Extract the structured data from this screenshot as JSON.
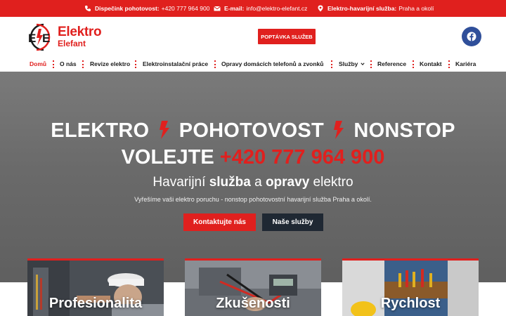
{
  "topbar": {
    "dispatch_label": "Dispečink pohotovost:",
    "dispatch_value": "+420 777 964 900",
    "email_label": "E-mail:",
    "email_value": "info@elektro-elefant.cz",
    "emergency_label": "Elektro-havarijní služba:",
    "emergency_value": "Praha a okolí"
  },
  "header": {
    "logo_line1": "Elektro",
    "logo_line2": "Elefant",
    "cta_label": "POPTÁVKA SLUŽEB"
  },
  "nav": {
    "items": [
      {
        "label": "Domů",
        "active": true
      },
      {
        "label": "O nás"
      },
      {
        "label": "Revize elektro"
      },
      {
        "label": "Elektroinstalační práce"
      },
      {
        "label": "Opravy domácích telefonů a zvonků"
      },
      {
        "label": "Služby"
      },
      {
        "label": "Reference"
      },
      {
        "label": "Kontakt"
      },
      {
        "label": "Kariéra"
      }
    ]
  },
  "hero": {
    "line1_a": "ELEKTRO",
    "line1_b": "POHOTOVOST",
    "line1_c": "NONSTOP",
    "line2_prefix": "VOLEJTE",
    "line2_phone": "+420 777 964 900",
    "line3_a": "Havarijní",
    "line3_b": "služba",
    "line3_c": "a",
    "line3_d": "opravy",
    "line3_e": "elektro",
    "subtitle": "Vyřešíme vaši elektro poruchu - nonstop pohotovostní havarijní služba Praha a okolí.",
    "button_primary": "Kontaktujte nás",
    "button_secondary": "Naše služby"
  },
  "cards": [
    {
      "title": "Profesionalita"
    },
    {
      "title": "Zkušenosti"
    },
    {
      "title": "Rychlost"
    }
  ],
  "colors": {
    "brand_red": "#e0201e",
    "dark_button": "#1f2833",
    "facebook_blue": "#2f4f9a"
  }
}
